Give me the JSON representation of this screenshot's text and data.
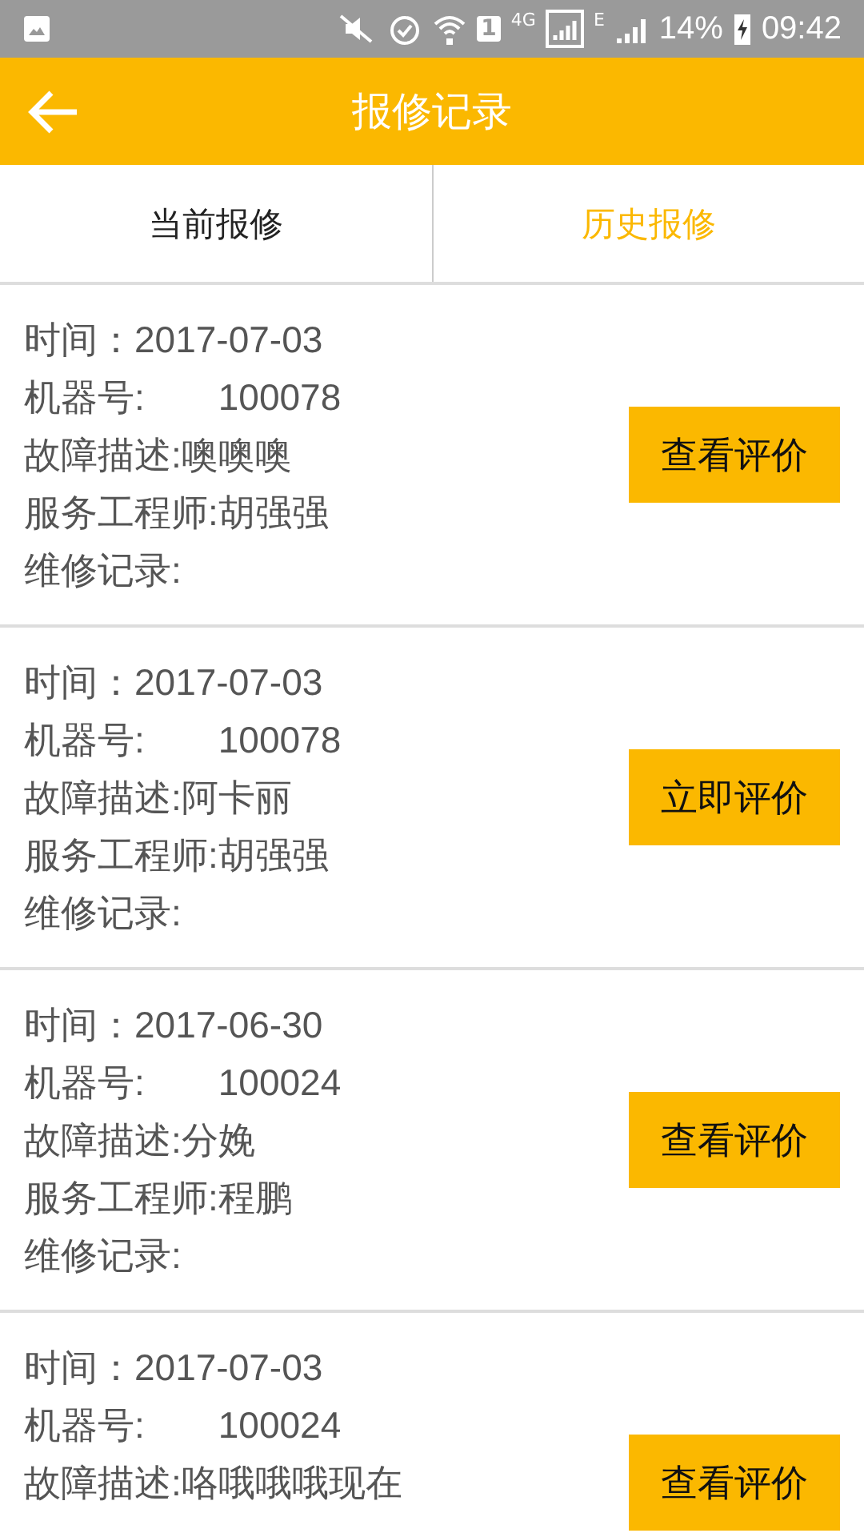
{
  "status_bar": {
    "sim": "1",
    "network": "4G",
    "network_2": "E",
    "battery": "14%",
    "time": "09:42"
  },
  "header": {
    "title": "报修记录"
  },
  "tabs": [
    {
      "label": "当前报修",
      "selected": false
    },
    {
      "label": "历史报修",
      "selected": true
    }
  ],
  "records": [
    {
      "time": "时间：2017-07-03",
      "machine_label": "机器号:",
      "machine_no": "100078",
      "fault": "故障描述:噢噢噢",
      "engineer": "服务工程师:胡强强",
      "repair_log": "维修记录:",
      "button": "查看评价"
    },
    {
      "time": "时间：2017-07-03",
      "machine_label": "机器号:",
      "machine_no": "100078",
      "fault": "故障描述:阿卡丽",
      "engineer": "服务工程师:胡强强",
      "repair_log": "维修记录:",
      "button": "立即评价"
    },
    {
      "time": "时间：2017-06-30",
      "machine_label": "机器号:",
      "machine_no": "100024",
      "fault": "故障描述:分娩",
      "engineer": "服务工程师:程鹏",
      "repair_log": "维修记录:",
      "button": "查看评价"
    },
    {
      "time": "时间：2017-07-03",
      "machine_label": "机器号:",
      "machine_no": "100024",
      "fault": "故障描述:咯哦哦哦现在",
      "button": "查看评价"
    }
  ]
}
